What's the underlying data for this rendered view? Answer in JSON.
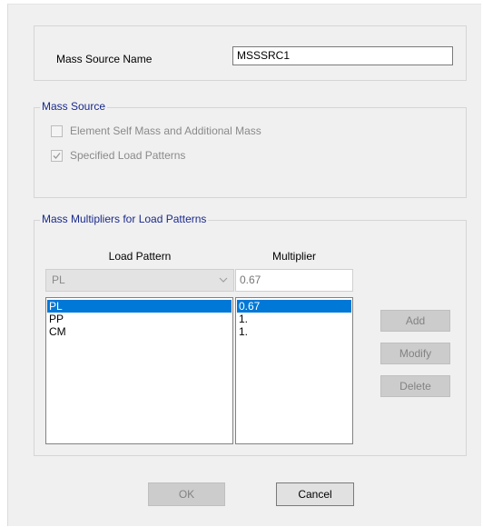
{
  "mass_source_name": {
    "label": "Mass Source Name",
    "value": "MSSSRC1"
  },
  "mass_source": {
    "title": "Mass Source",
    "options": [
      {
        "label": "Element Self Mass and Additional Mass",
        "checked": false
      },
      {
        "label": "Specified Load Patterns",
        "checked": true
      }
    ]
  },
  "multipliers": {
    "title": "Mass Multipliers for Load Patterns",
    "col_load_pattern": "Load Pattern",
    "col_multiplier": "Multiplier",
    "load_pattern_select": "PL",
    "multiplier_input": "0.67",
    "rows": [
      {
        "pattern": "PL",
        "multiplier": "0.67",
        "selected": true
      },
      {
        "pattern": "PP",
        "multiplier": "1.",
        "selected": false
      },
      {
        "pattern": "CM",
        "multiplier": "1.",
        "selected": false
      }
    ],
    "buttons": {
      "add": "Add",
      "modify": "Modify",
      "delete": "Delete"
    }
  },
  "footer": {
    "ok": "OK",
    "cancel": "Cancel"
  },
  "colors": {
    "accent": "#0078d7",
    "group_title": "#1a2a8c"
  }
}
